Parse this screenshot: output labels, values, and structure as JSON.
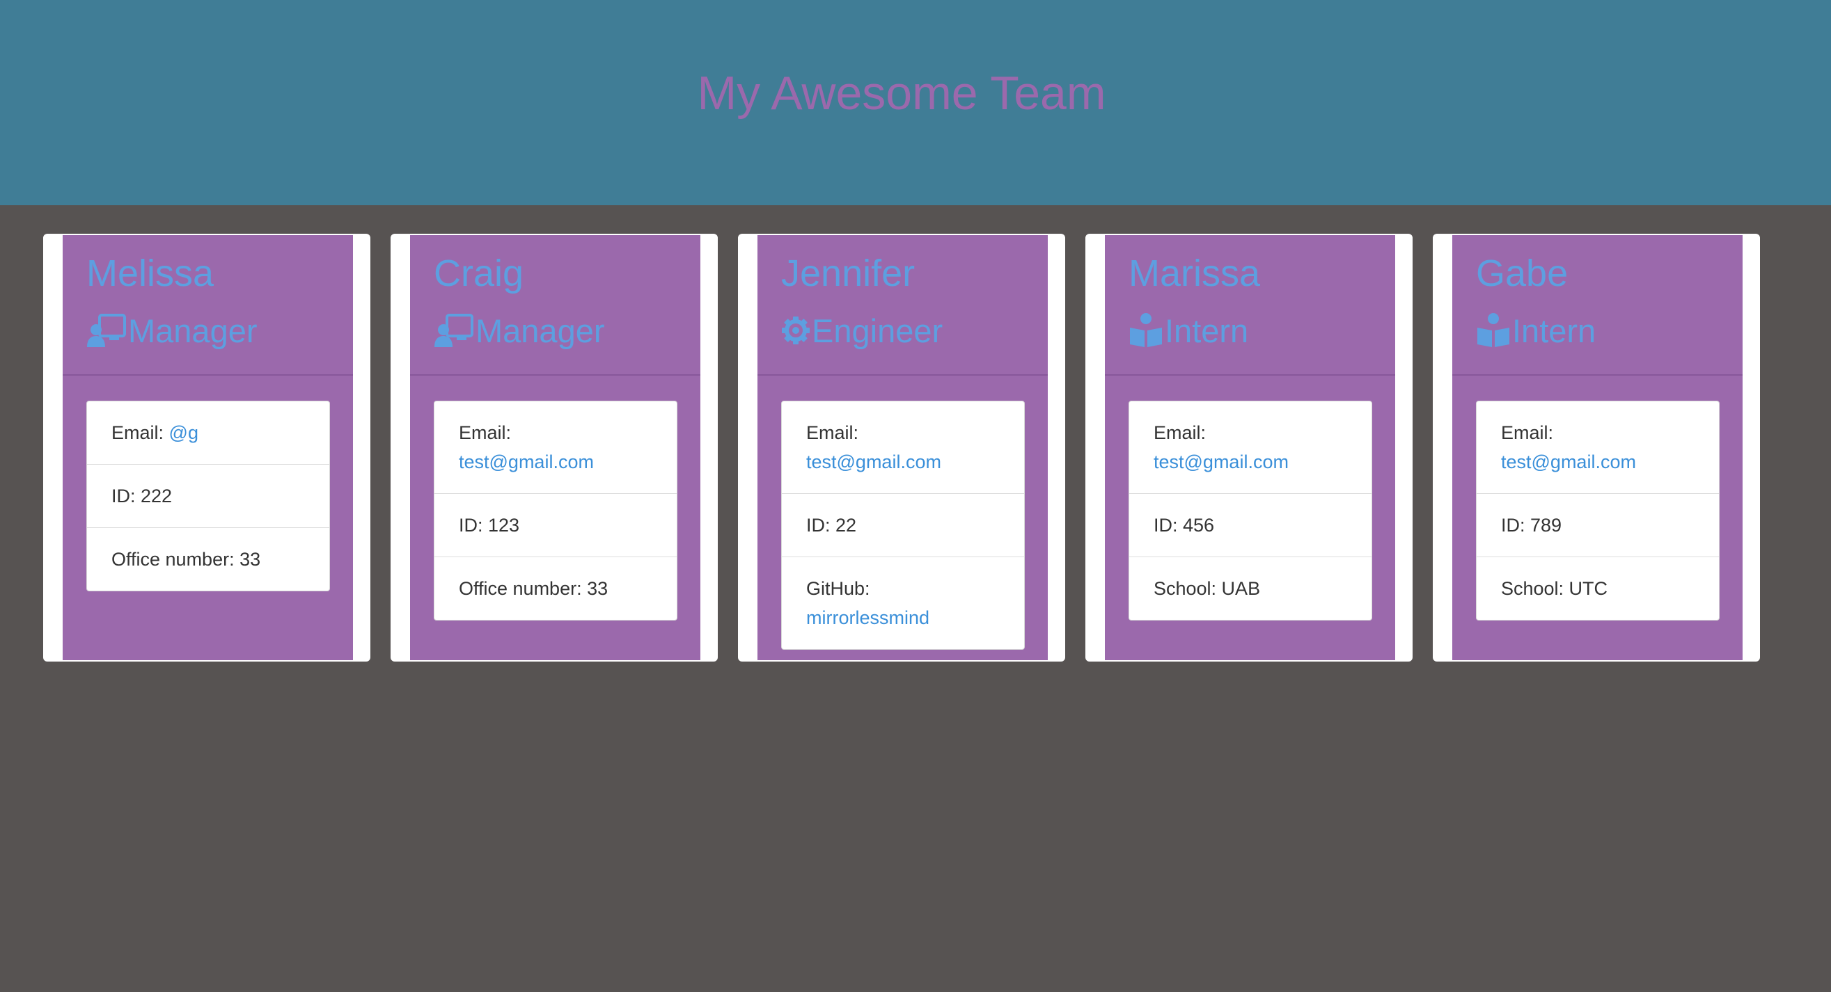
{
  "header": {
    "title": "My Awesome Team"
  },
  "colors": {
    "header_bg": "#407d96",
    "page_bg": "#575352",
    "card_purple": "#9b69ac",
    "accent_blue": "#5d9fe0",
    "link_blue": "#3a8fd9"
  },
  "cards": [
    {
      "name": "Melissa",
      "role": "Manager",
      "role_icon": "chalkboard-teacher-icon",
      "email_label": "Email:",
      "email": "@g",
      "id_text": "ID: 222",
      "extra_label": "Office number: 33",
      "extra_link": ""
    },
    {
      "name": "Craig",
      "role": "Manager",
      "role_icon": "chalkboard-teacher-icon",
      "email_label": "Email:",
      "email": "test@gmail.com",
      "id_text": "ID: 123",
      "extra_label": "Office number: 33",
      "extra_link": ""
    },
    {
      "name": "Jennifer",
      "role": "Engineer",
      "role_icon": "gear-icon",
      "email_label": "Email:",
      "email": "test@gmail.com",
      "id_text": "ID: 22",
      "extra_label": "GitHub:",
      "extra_link": "mirrorlessmind"
    },
    {
      "name": "Marissa",
      "role": "Intern",
      "role_icon": "book-reader-icon",
      "email_label": "Email:",
      "email": "test@gmail.com",
      "id_text": "ID: 456",
      "extra_label": "School: UAB",
      "extra_link": ""
    },
    {
      "name": "Gabe",
      "role": "Intern",
      "role_icon": "book-reader-icon",
      "email_label": "Email:",
      "email": "test@gmail.com",
      "id_text": "ID: 789",
      "extra_label": "School: UTC",
      "extra_link": ""
    }
  ]
}
